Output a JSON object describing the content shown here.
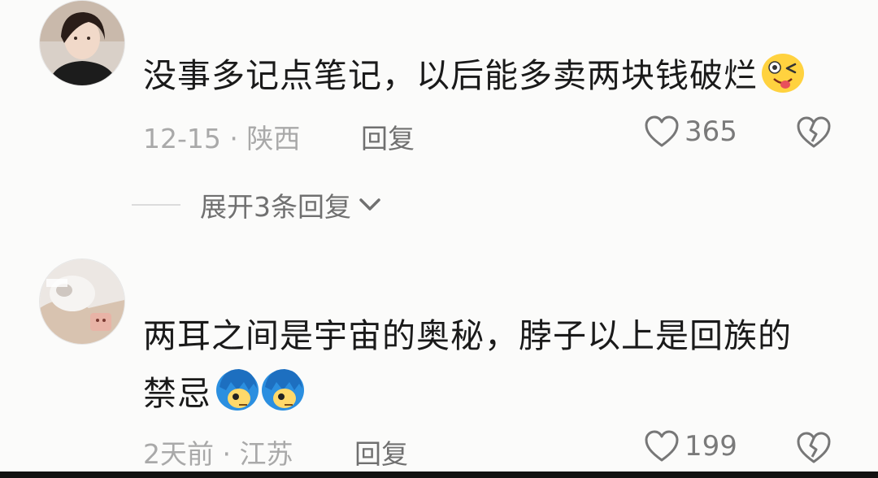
{
  "comments": [
    {
      "text": "没事多记点笔记，以后能多卖两块钱破烂",
      "emoji": "winking-tongue-emoji",
      "date": "12-15",
      "location": "陕西",
      "reply_label": "回复",
      "likes": "365"
    },
    {
      "text_line1": "两耳之间是宇宙的奥秘，脖子以上是回族的",
      "text_line2": "禁忌",
      "emoji": "blue-hair-face-emoji",
      "date": "2天前",
      "location": "江苏",
      "reply_label": "回复",
      "likes": "199"
    }
  ],
  "expand_replies": "展开3条回复",
  "separator": "·",
  "colors": {
    "background": "#fbfbfa",
    "text": "#1a1a1a",
    "meta": "#a9a9a9",
    "action": "#707070"
  }
}
